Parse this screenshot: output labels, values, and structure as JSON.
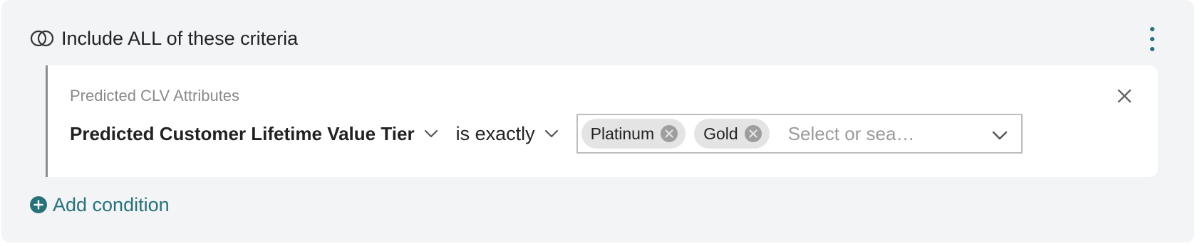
{
  "group": {
    "title": "Include ALL of these criteria"
  },
  "condition": {
    "category_label": "Predicted CLV Attributes",
    "attribute": "Predicted Customer Lifetime Value Tier",
    "operator": "is exactly",
    "chips": [
      "Platinum",
      "Gold"
    ],
    "placeholder": "Select or sea…"
  },
  "add_condition_label": "Add condition",
  "colors": {
    "accent": "#27717b",
    "panel_bg": "#f3f4f6",
    "chip_bg": "#e4e4e4",
    "card_border": "#8c8c8c"
  },
  "icons": {
    "group": "venn-icon",
    "menu": "kebab-menu-icon",
    "remove": "close-icon",
    "dropdown": "chevron-down-icon",
    "chip_remove": "circle-x-icon",
    "add": "plus-circle-icon"
  }
}
